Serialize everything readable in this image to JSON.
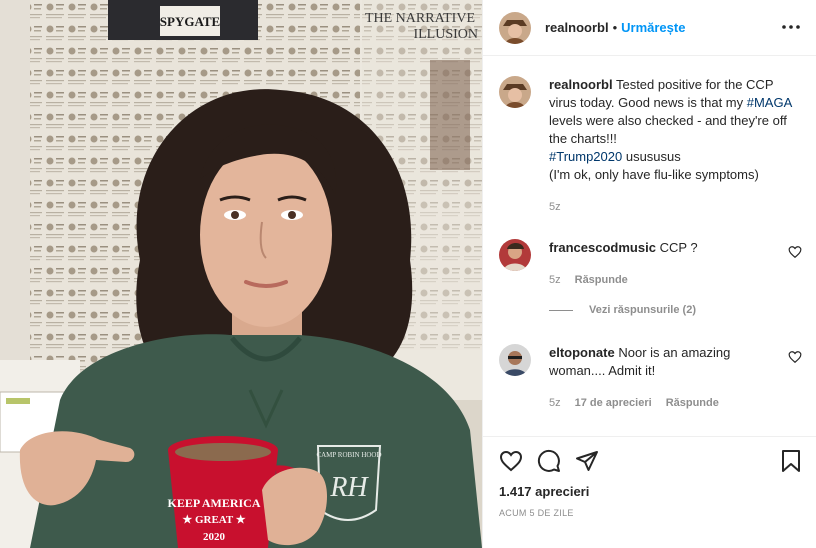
{
  "post": {
    "username": "realnoorbl",
    "follow_label": "Urmărește",
    "caption": {
      "username": "realnoorbl",
      "text_1": "Tested positive for the CCP virus today. Good news is that my ",
      "hashtag_1": "#MAGA",
      "text_2": " levels were also checked - and they're off the charts!!! ",
      "hashtag_2": "#Trump2020",
      "text_3": " usususus",
      "text_4": "(I'm ok, only have flu-like symptoms)",
      "time": "5z"
    },
    "comments": [
      {
        "username": "francescodmusic",
        "text": "CCP ?",
        "time": "5z",
        "reply_label": "Răspunde"
      },
      {
        "username": "eltoponate",
        "text": "Noor is an amazing woman.... Admit it!",
        "time": "5z",
        "likes": "17 de aprecieri",
        "reply_label": "Răspunde"
      }
    ],
    "view_replies": "Vezi răspunsurile (2)",
    "likes": "1.417 aprecieri",
    "ago": "ACUM 5 DE ZILE"
  },
  "photo": {
    "newspaper_headline_1": "SPYGATE",
    "newspaper_headline_2": "THE NARRATIVE",
    "newspaper_headline_3": "ILLUSION",
    "mug_text_1": "KEEP AMERICA",
    "mug_text_2": "★ GREAT ★",
    "mug_text_3": "2020",
    "sweatshirt_logo_top": "CAMP ROBIN HOOD",
    "sweatshirt_logo": "RH"
  },
  "colors": {
    "link": "#0095f6",
    "hashtag": "#00376b",
    "meta": "#8e8e8e",
    "sweatshirt": "#3e5a4c",
    "mug": "#c8102e"
  },
  "icons": [
    "more-options-icon",
    "heart-icon",
    "comment-icon",
    "share-icon",
    "bookmark-icon"
  ]
}
